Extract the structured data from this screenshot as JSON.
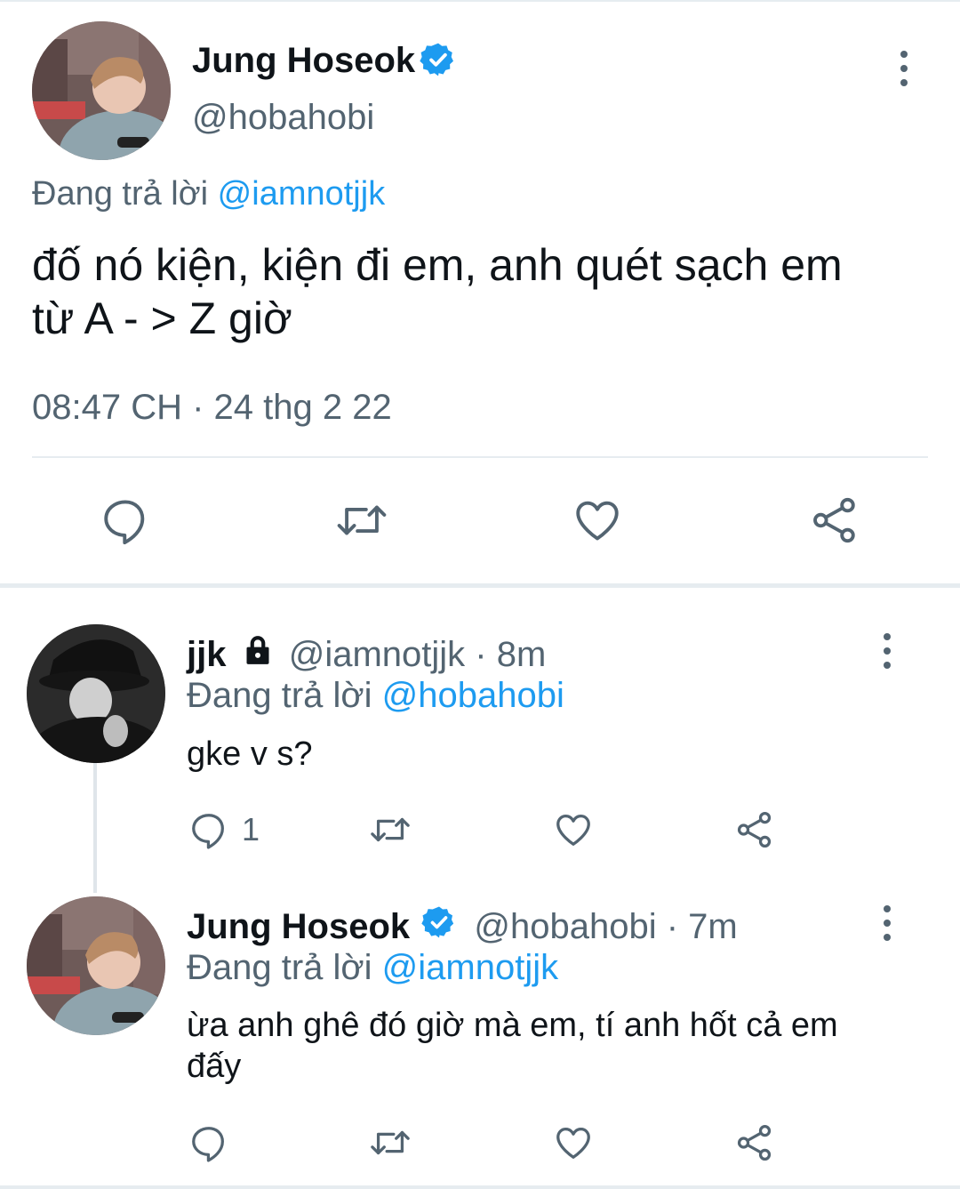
{
  "main_tweet": {
    "author_name": "Jung Hoseok",
    "author_handle": "@hobahobi",
    "reply_prefix": "Đang trả lời",
    "reply_to": "@iamnotjjk",
    "text_line1": "đố nó kiện, kiện đi em, anh quét sạch em",
    "text_line2": "từ A - > Z giờ",
    "timestamp": "08:47 CH · 24 thg 2 22"
  },
  "reply1": {
    "author_name": "jjk",
    "author_handle": "@iamnotjjk",
    "time": "· 8m",
    "reply_prefix": "Đang trả lời",
    "reply_to": "@hobahobi",
    "text": "gke v s?",
    "reply_count": "1"
  },
  "reply2": {
    "author_name": "Jung Hoseok",
    "author_handle": "@hobahobi",
    "time": "· 7m",
    "reply_prefix": "Đang trả lời",
    "reply_to": "@iamnotjjk",
    "text_line1": "ừa anh ghê đó giờ mà em, tí anh hốt cả em",
    "text_line2": "đấy"
  },
  "colors": {
    "accent": "#1d9bf0",
    "muted": "#536471",
    "divider": "#e6ecf0"
  },
  "icons": [
    "verified-badge-icon",
    "more-options-icon",
    "reply-icon",
    "retweet-icon",
    "like-icon",
    "share-icon",
    "lock-icon"
  ]
}
